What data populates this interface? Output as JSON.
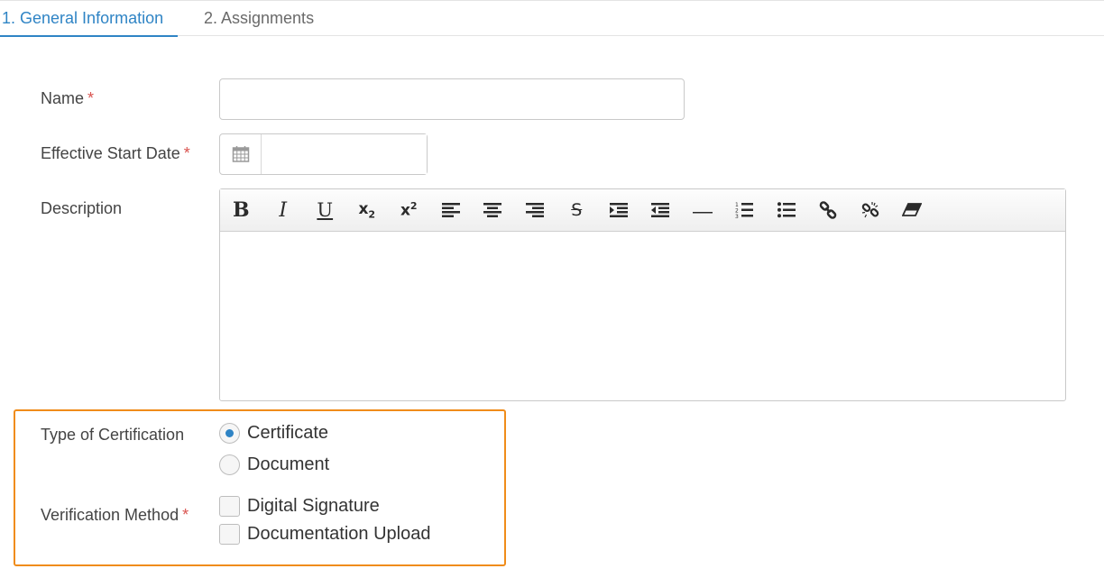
{
  "tabs": [
    {
      "label": "1. General Information",
      "active": true
    },
    {
      "label": "2. Assignments",
      "active": false
    }
  ],
  "form": {
    "name_label": "Name",
    "name_value": "",
    "start_date_label": "Effective Start Date",
    "start_date_value": "",
    "description_label": "Description",
    "required_marker": "*",
    "type_label": "Type of Certification",
    "type_options": [
      {
        "label": "Certificate",
        "checked": true
      },
      {
        "label": "Document",
        "checked": false
      }
    ],
    "verification_label": "Verification Method",
    "verification_options": [
      {
        "label": "Digital Signature",
        "checked": false
      },
      {
        "label": "Documentation Upload",
        "checked": false
      }
    ]
  },
  "toolbar": [
    "bold-icon",
    "italic-icon",
    "underline-icon",
    "subscript-icon",
    "superscript-icon",
    "align-left-icon",
    "align-center-icon",
    "align-right-icon",
    "strikethrough-icon",
    "indent-icon",
    "outdent-icon",
    "horizontal-rule-icon",
    "ordered-list-icon",
    "unordered-list-icon",
    "link-icon",
    "unlink-icon",
    "eraser-icon"
  ],
  "colors": {
    "accent": "#2f84c5",
    "required": "#d9534f",
    "highlight": "#f08c1a"
  }
}
